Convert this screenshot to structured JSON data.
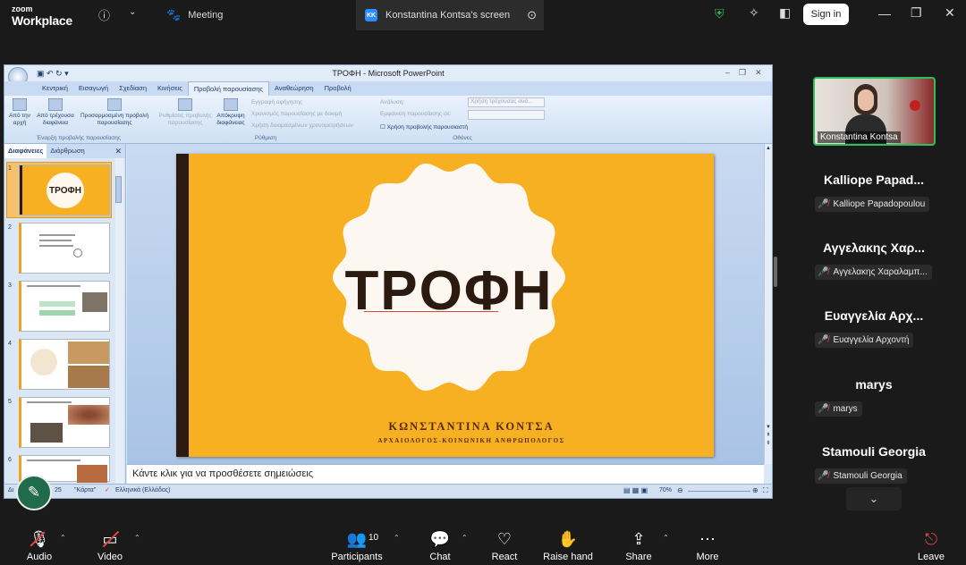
{
  "topbar": {
    "logo_small": "zoom",
    "logo_large": "Workplace",
    "meeting_tab": "Meeting",
    "screen_tab_initials": "KK",
    "screen_tab": "Konstantina Kontsa's screen",
    "signin": "Sign in"
  },
  "ppt": {
    "title": "ΤΡΟΦΗ - Microsoft PowerPoint",
    "tabs": [
      "Κεντρική",
      "Εισαγωγή",
      "Σχεδίαση",
      "Κινήσεις",
      "Προβολή παρουσίασης",
      "Αναθεώρηση",
      "Προβολή"
    ],
    "ribbon": {
      "from_start": "Από την αρχή",
      "from_current": "Από τρέχουσα διαφάνεια",
      "custom_show": "Προσαρμοσμένη προβολή παρουσίασης",
      "setup": "Ρυθμίσεις προβολής παρουσίασης",
      "hide_slide": "Απόκρυψη διαφάνειας",
      "record": "Εγγραφή αφήγησης",
      "rehearse": "Χρονισμός παρουσίασης με δοκιμή",
      "use_timings": "Χρήση δοκιμασμένων χρονομετρήσεων",
      "resolution": "Ανάλυση:",
      "resolution_value": "Χρήση τρέχουσας ανά...",
      "show_on": "Εμφάνιση παρουσίασης σε:",
      "presenter_view": "Χρήση προβολής παρουσιαστή",
      "group_start": "Έναρξη προβολής παρουσίασης",
      "group_setup": "Ρύθμιση",
      "group_monitors": "Οθόνες"
    },
    "pane_tabs": [
      "Διαφάνειες",
      "Διάρθρωση"
    ],
    "slide_numbers": [
      "1",
      "2",
      "3",
      "4",
      "5",
      "6"
    ],
    "slide": {
      "title": "ΤΡΟΦΗ",
      "author": "ΚΩΝΣΤΑΝΤΙΝΑ ΚΟΝΤΣΑ",
      "subtitle": "ΑΡΧΑΙΟΛΟΓΟΣ-ΚΟΙΝΩΝΙΚΗ ΑΝΘΡΩΠΟΛΟΓΟΣ"
    },
    "notes_placeholder": "Κάντε κλικ για να προσθέσετε σημειώσεις",
    "status": {
      "slide_info": "Δι",
      "slide_count": "25",
      "theme": "\"Κάρτα\"",
      "language": "Ελληνικά (Ελλάδος)",
      "zoom": "70%"
    }
  },
  "participants": {
    "video_name": "Konstantina Kontsa",
    "list": [
      {
        "display": "Kalliope Papad...",
        "tag": "Kalliope Papadopoulou"
      },
      {
        "display": "Αγγελακης Χαρ...",
        "tag": "Αγγελακης Χαραλαμπ..."
      },
      {
        "display": "Ευαγγελία Αρχ...",
        "tag": "Ευαγγελία Αρχοντή"
      },
      {
        "display": "marys",
        "tag": "marys"
      },
      {
        "display": "Stamouli Georgia",
        "tag": "Stamouli Georgia"
      }
    ]
  },
  "bottombar": {
    "audio": "Audio",
    "video": "Video",
    "participants": "Participants",
    "participants_count": "10",
    "chat": "Chat",
    "react": "React",
    "raise_hand": "Raise hand",
    "share": "Share",
    "more": "More",
    "leave": "Leave"
  },
  "colors": {
    "accent": "#2d8cff",
    "slide_bg": "#f6b021",
    "leave": "#e04848"
  }
}
